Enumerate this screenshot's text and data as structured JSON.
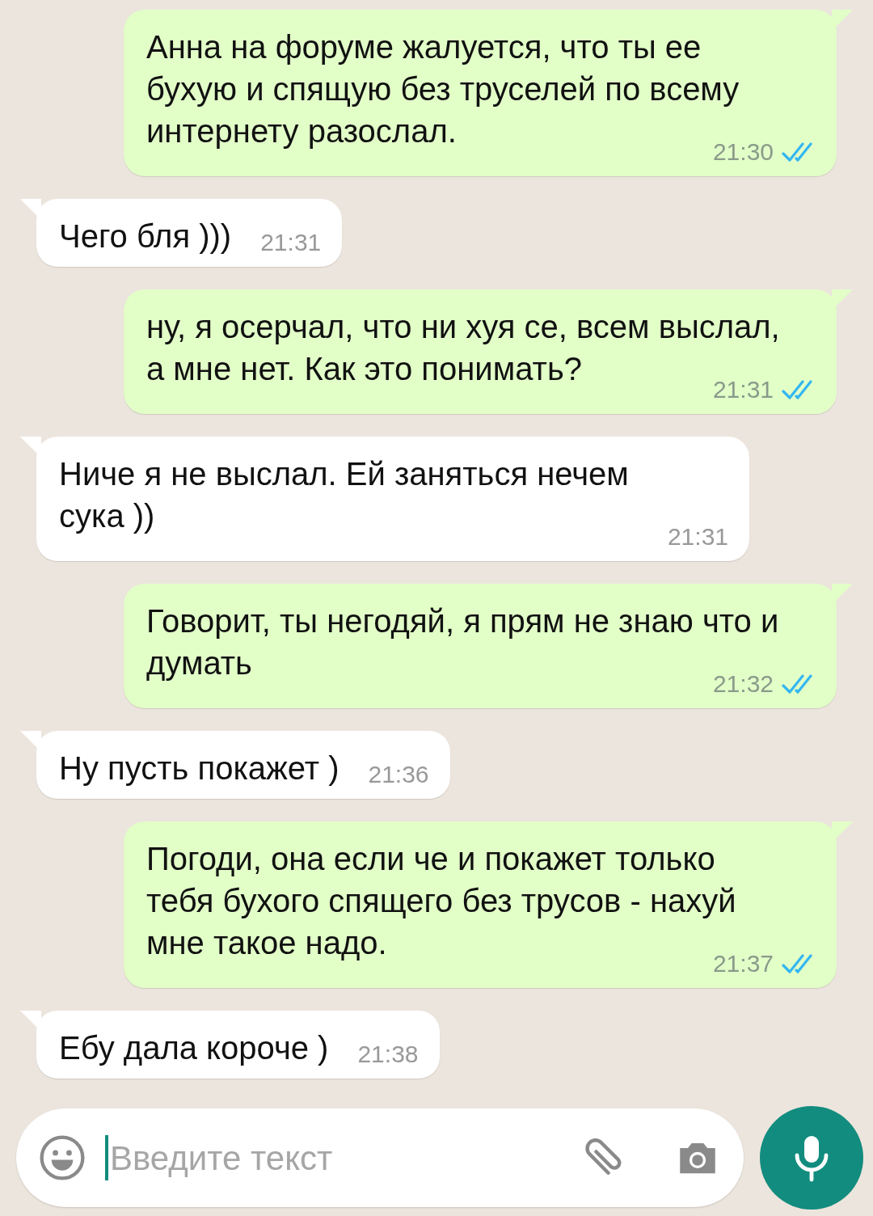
{
  "messages": [
    {
      "kind": "out",
      "text": "Анна на форуме жалуется, что ты ее бухую и спящую без труселей по всему интернету разослал.",
      "time": "21:30",
      "read": true
    },
    {
      "kind": "in",
      "text": "Чего бля )))",
      "time": "21:31"
    },
    {
      "kind": "out",
      "text": "ну, я осерчал, что ни хуя се, всем выслал, а мне нет. Как это понимать?",
      "time": "21:31",
      "read": true
    },
    {
      "kind": "in",
      "text": "Ниче я не выслал. Ей заняться нечем сука ))",
      "time": "21:31"
    },
    {
      "kind": "out",
      "text": "Говорит, ты негодяй, я прям не знаю что и думать",
      "time": "21:32",
      "read": true
    },
    {
      "kind": "in",
      "text": "Ну пусть покажет )",
      "time": "21:36"
    },
    {
      "kind": "out",
      "text": "Погоди, она если че и покажет только тебя бухого спящего без трусов - нахуй мне такое надо.",
      "time": "21:37",
      "read": true
    },
    {
      "kind": "in",
      "text": "Ебу дала короче )",
      "time": "21:38"
    }
  ],
  "composer": {
    "placeholder": "Введите текст"
  }
}
